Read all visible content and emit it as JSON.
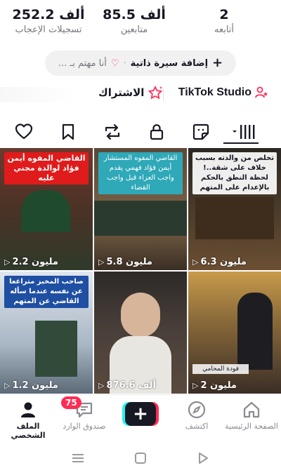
{
  "stats": {
    "following": {
      "value": "2",
      "label": "أتابعه"
    },
    "followers": {
      "value": "85.5 ألف",
      "label": "متابعين"
    },
    "likes": {
      "value": "252.2 ألف",
      "label": "تسجيلات الإعجاب"
    }
  },
  "bio": {
    "add_label": "إضافة سيرة ذاتية",
    "interests_label": "أنا مهتم بـ ..."
  },
  "links": {
    "studio_label": "TikTok Studio",
    "subscription_label": "الاشتراك"
  },
  "tabs": [
    {
      "icon": "grid-icon",
      "active": true
    },
    {
      "icon": "face-sticker-icon"
    },
    {
      "icon": "lock-icon"
    },
    {
      "icon": "repost-icon"
    },
    {
      "icon": "bookmark-icon"
    },
    {
      "icon": "heart-icon"
    }
  ],
  "videos": [
    {
      "caption": "تخلص من والدته بسبب خلاف على شقة..! لحظة النطق بالحكم بالإعدام على المتهم",
      "views": "6.3 مليون"
    },
    {
      "caption": "القاضي المفوه المستشار أيمن فؤاد فهمي يقدم واجب العزاء قبل واجب القضاء",
      "views": "5.8 مليون"
    },
    {
      "caption": "القاضي المفوه أيمن فؤاد لوالدة مجني عليه",
      "views": "2.2 مليون"
    },
    {
      "caption": "فودة المحامي",
      "views": "2 مليون"
    },
    {
      "caption": "",
      "views": "876.6 ألف"
    },
    {
      "caption": "صاحب المخبز متراغعا عن نفسه عندما سأله القاضي عن المتهم",
      "views": "1.2 مليون"
    }
  ],
  "tabbar": {
    "home": "الصفحة الرئيسية",
    "discover": "اكتشف",
    "inbox": "صندوق الوارد",
    "inbox_badge": "75",
    "profile": "الملف الشخصي"
  },
  "colors": {
    "accent": "#fe2c55",
    "cyan": "#25f4ee",
    "text": "#161823",
    "secondary": "#75757d"
  }
}
